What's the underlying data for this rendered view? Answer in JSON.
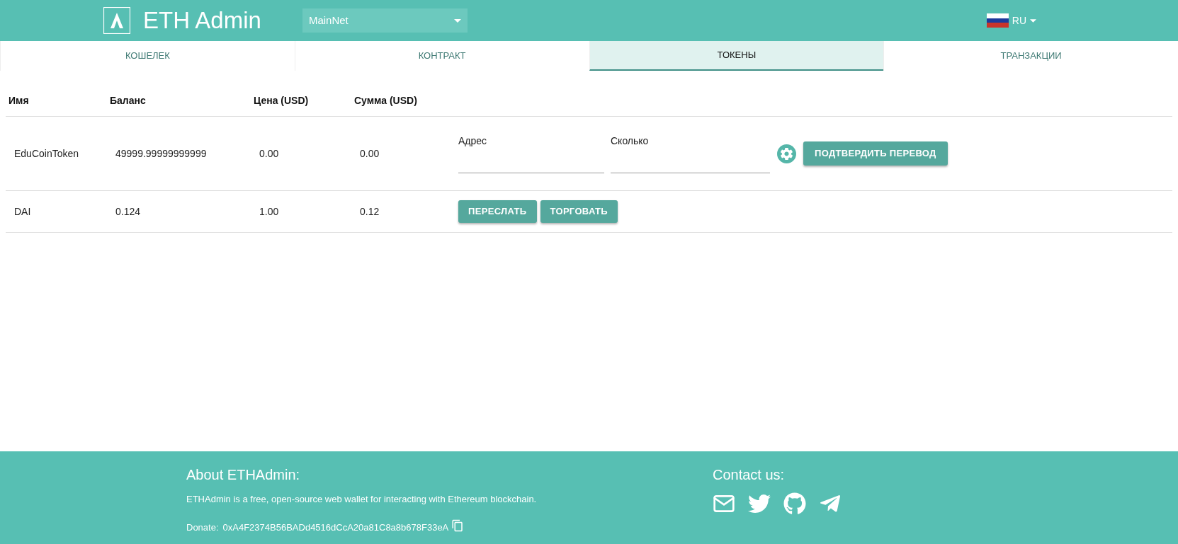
{
  "header": {
    "title": "ETH Admin",
    "network": "MainNet",
    "language": "RU"
  },
  "tabs": [
    {
      "label": "КОШЕЛЕК",
      "selected": false
    },
    {
      "label": "КОНТРАКТ",
      "selected": false
    },
    {
      "label": "ТОКЕНЫ",
      "selected": true
    },
    {
      "label": "ТРАНЗАКЦИИ",
      "selected": false
    }
  ],
  "table": {
    "columns": [
      "Имя",
      "Баланс",
      "Цена (USD)",
      "Сумма (USD)"
    ],
    "rows": [
      {
        "kind": "transfer",
        "cells": [
          "EduCoinToken",
          "49999.99999999999",
          "0.00",
          "0.00"
        ],
        "fields": [
          {
            "label": "Адрес"
          },
          {
            "label": "Сколько"
          }
        ],
        "confirm": "ПОДТВЕРДИТЬ ПЕРЕВОД"
      },
      {
        "kind": "actions",
        "cells": [
          "DAI",
          "0.124",
          "1.00",
          "0.12"
        ],
        "buttons": [
          "ПЕРЕСЛАТЬ",
          "ТОРГОВАТЬ"
        ]
      }
    ]
  },
  "footer": {
    "about_title": "About ETHAdmin:",
    "about_text": "ETHAdmin is a free, open-source web wallet for interacting with Ethereum blockchain.",
    "donate_label": "Donate:",
    "donate_address": "0xA4F2374B56BADd4516dCcA20a81C8a8b678F33eA",
    "contact_title": "Contact us:"
  }
}
